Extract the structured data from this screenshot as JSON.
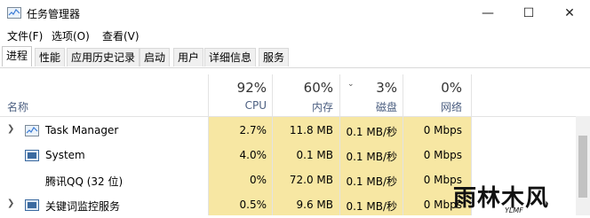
{
  "window": {
    "title": "任务管理器",
    "controls": {
      "minimize": "—",
      "maximize": "☐",
      "close": "✕"
    }
  },
  "menu": [
    "文件(F)",
    "选项(O)",
    "查看(V)"
  ],
  "tabs": [
    "进程",
    "性能",
    "应用历史记录",
    "启动",
    "用户",
    "详细信息",
    "服务"
  ],
  "active_tab": 0,
  "columns": {
    "name": "名称",
    "cpu": {
      "pct": "92%",
      "label": "CPU"
    },
    "memory": {
      "pct": "60%",
      "label": "内存"
    },
    "disk": {
      "pct": "3%",
      "label": "磁盘"
    },
    "network": {
      "pct": "0%",
      "label": "网络"
    }
  },
  "rows": [
    {
      "name": "Task Manager",
      "icon": "task-manager-icon",
      "expandable": true,
      "cpu": "2.7%",
      "memory": "11.8 MB",
      "disk": "0.1 MB/秒",
      "network": "0 Mbps"
    },
    {
      "name": "System",
      "icon": "system-icon",
      "expandable": false,
      "cpu": "4.0%",
      "memory": "0.1 MB",
      "disk": "0.1 MB/秒",
      "network": "0 Mbps"
    },
    {
      "name": "腾讯QQ (32 位)",
      "icon": "",
      "expandable": false,
      "cpu": "0%",
      "memory": "72.0 MB",
      "disk": "0.1 MB/秒",
      "network": "0 Mbps"
    },
    {
      "name": "关键词监控服务",
      "icon": "service-icon",
      "expandable": true,
      "cpu": "0.5%",
      "memory": "9.6 MB",
      "disk": "0.1 MB/秒",
      "network": "0 Mbps"
    }
  ],
  "watermark": {
    "text": "雨林木风",
    "sub": "YLMF"
  },
  "colors": {
    "highlight": "#f7e7a3",
    "header_label": "#4d6082"
  }
}
